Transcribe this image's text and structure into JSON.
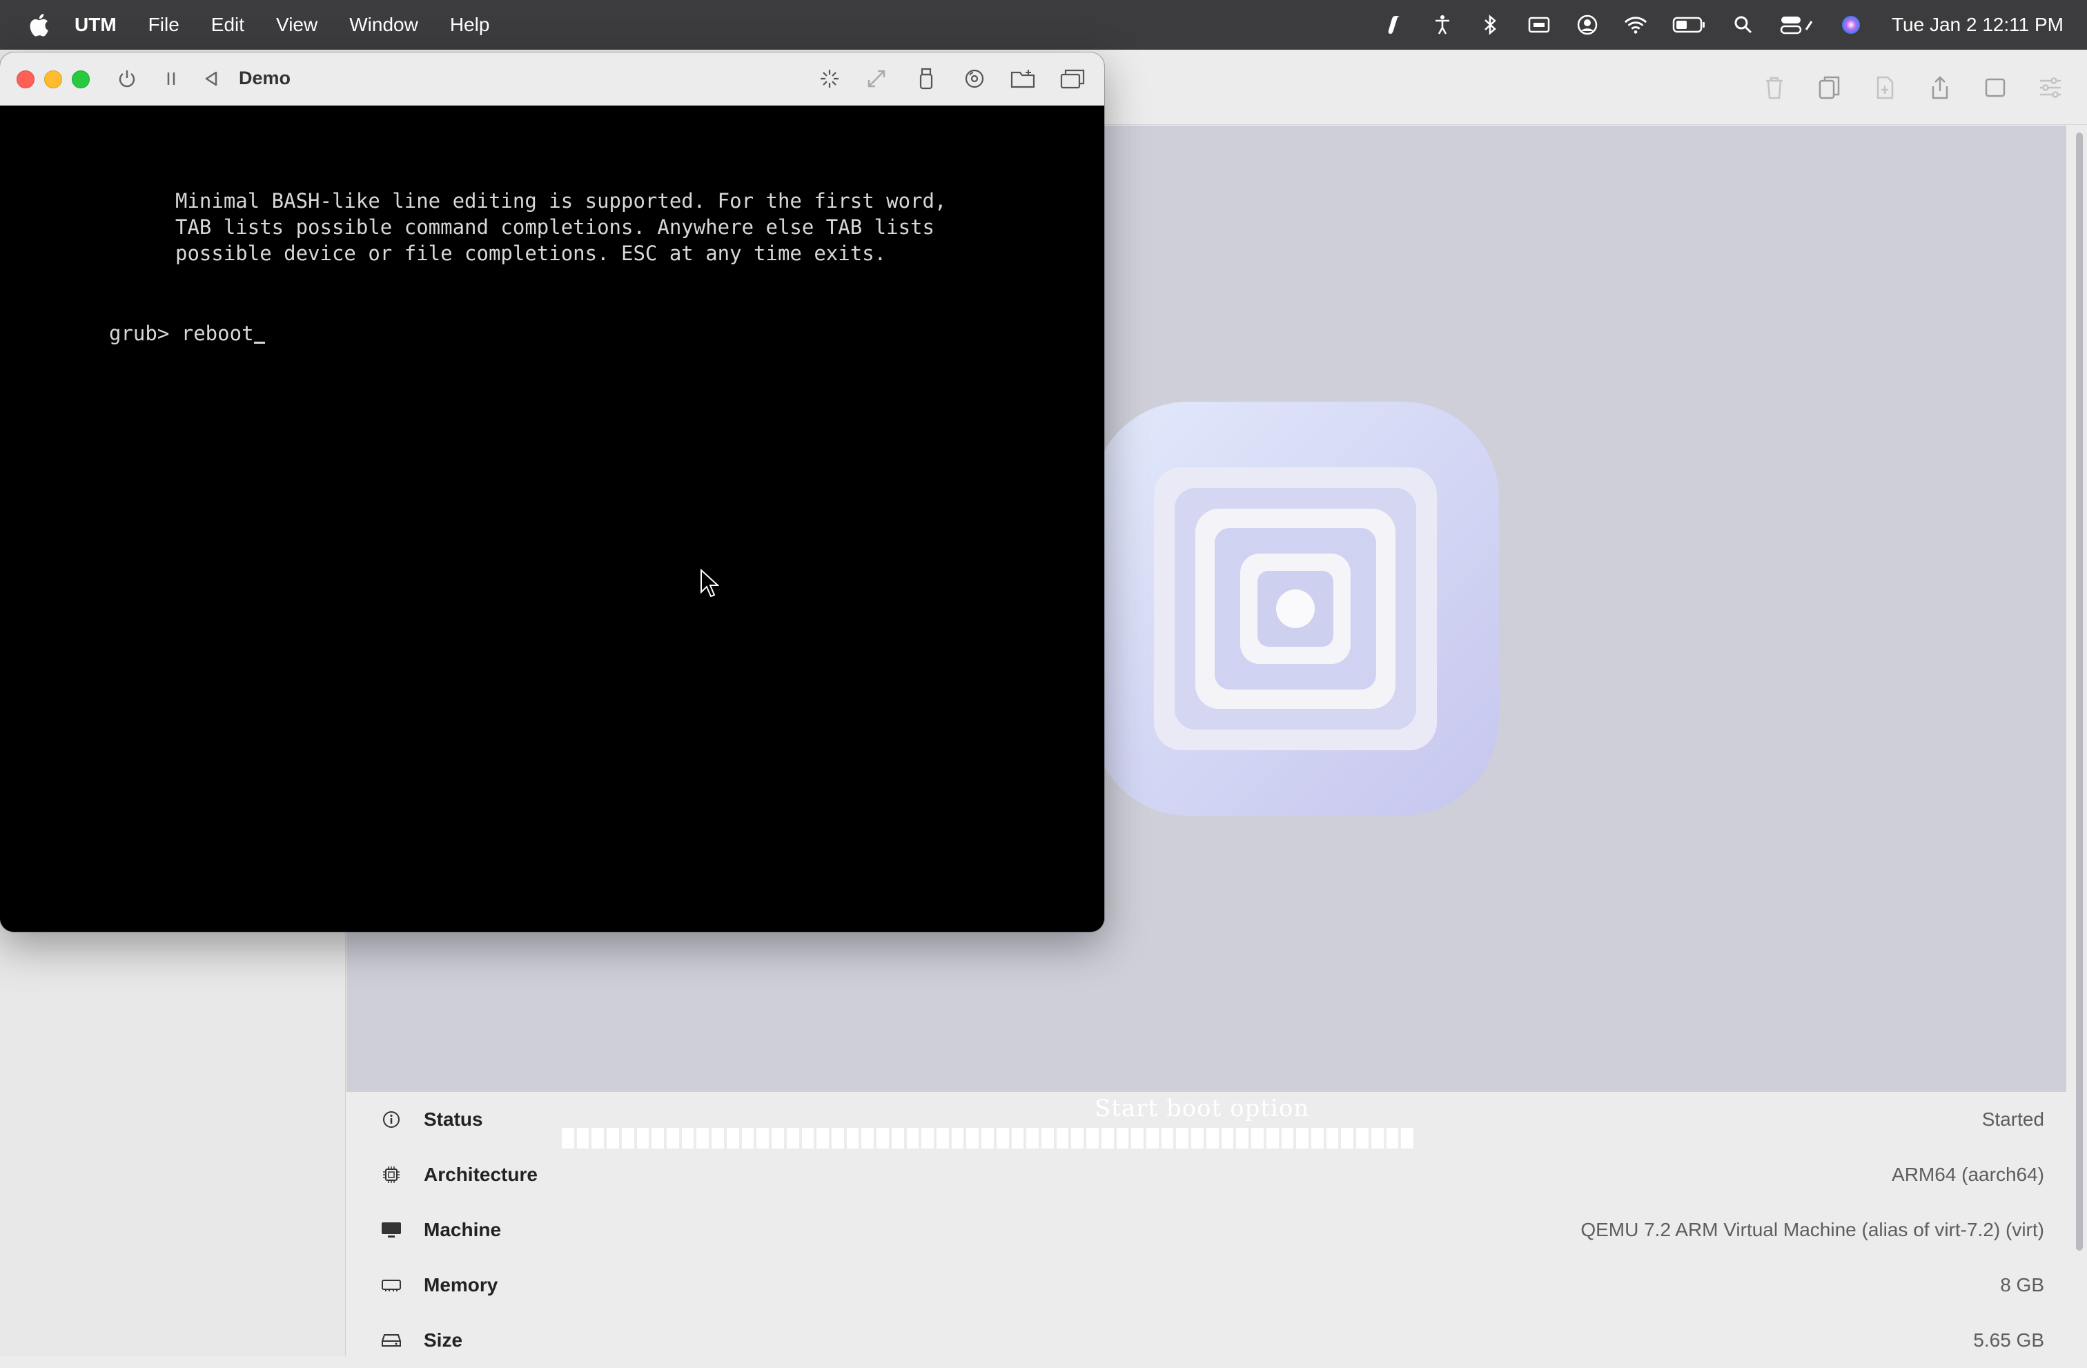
{
  "menubar": {
    "app_name": "UTM",
    "menus": [
      "File",
      "Edit",
      "View",
      "Window",
      "Help"
    ],
    "clock": "Tue Jan 2  12:11 PM",
    "status_icons": [
      "script-icon",
      "accessibility-icon",
      "bluetooth-icon",
      "keyboard-input-icon",
      "user-icon",
      "wifi-icon",
      "battery-icon",
      "spotlight-search-icon",
      "control-center-icon",
      "siri-icon"
    ]
  },
  "vm_window": {
    "title": "Demo",
    "terminal_lines": [
      "Minimal BASH-like line editing is supported. For the first word,",
      "TAB lists possible command completions. Anywhere else TAB lists",
      "possible device or file completions. ESC at any time exits."
    ],
    "prompt": "grub> ",
    "command": "reboot"
  },
  "preview": {
    "boot_text": "Start boot option",
    "boot_progress_segments": 57
  },
  "details": {
    "rows": [
      {
        "icon": "info-icon",
        "label": "Status",
        "value": "Started"
      },
      {
        "icon": "cpu-icon",
        "label": "Architecture",
        "value": "ARM64 (aarch64)"
      },
      {
        "icon": "display-icon",
        "label": "Machine",
        "value": "QEMU 7.2 ARM Virtual Machine (alias of virt-7.2) (virt)"
      },
      {
        "icon": "memory-icon",
        "label": "Memory",
        "value": "8 GB"
      },
      {
        "icon": "drive-icon",
        "label": "Size",
        "value": "5.65 GB"
      }
    ]
  },
  "colors": {
    "menubar_bg": "#3c3c3e",
    "preview_bg": "#cfcfd9",
    "terminal_bg": "#000000",
    "terminal_fg": "#d8d8d8"
  }
}
